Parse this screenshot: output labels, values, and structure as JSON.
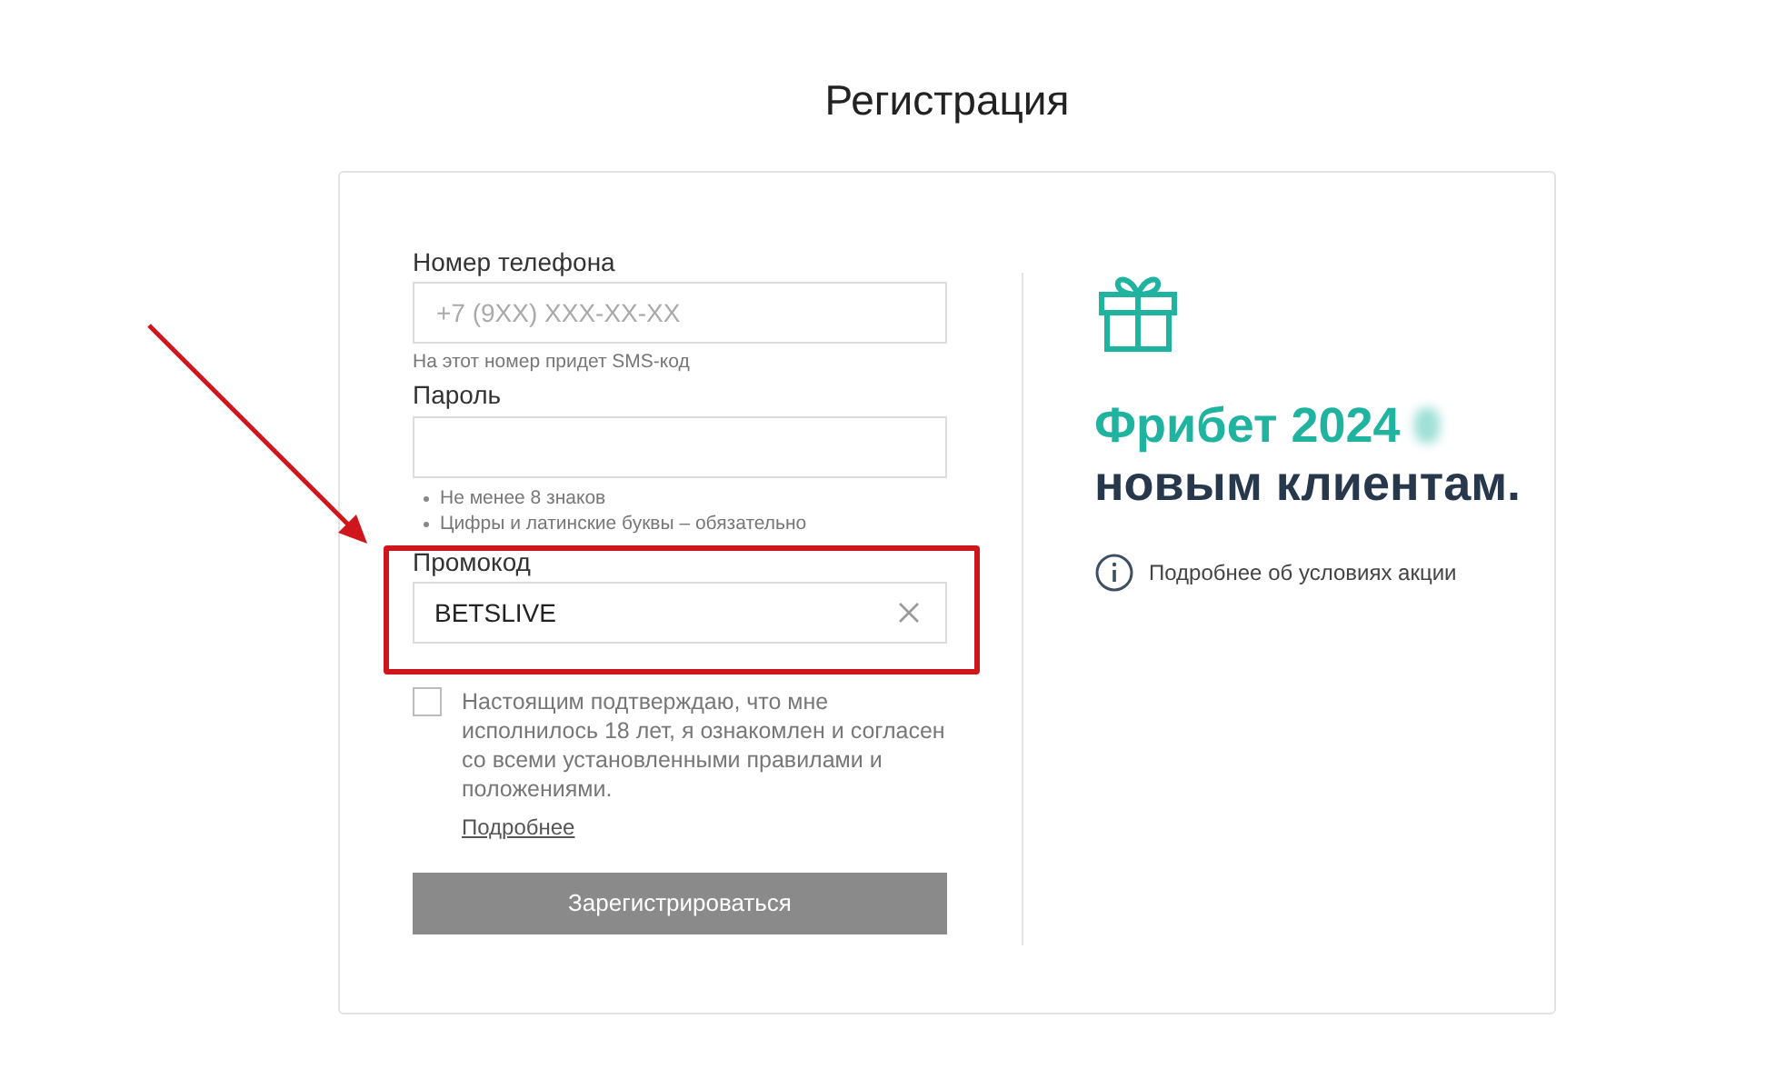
{
  "title": "Регистрация",
  "form": {
    "phone": {
      "label": "Номер телефона",
      "placeholder": "+7 (9XX) XXX-XX-XX",
      "hint": "На этот номер придет SMS-код"
    },
    "password": {
      "label": "Пароль",
      "rules": [
        "Не менее 8 знаков",
        "Цифры и латинские буквы – обязательно"
      ]
    },
    "promo": {
      "label": "Промокод",
      "value": "BETSLIVE",
      "highlighted": true
    },
    "consent": {
      "checked": false,
      "text": "Настоящим подтверждаю, что мне исполнилось 18 лет, я ознакомлен и согласен со всеми установленными правилами и положениями.",
      "link": "Подробнее"
    },
    "submit": {
      "label": "Зарегистрироваться",
      "disabled": true
    }
  },
  "promo_panel": {
    "headline": "Фрибет 2024",
    "subline": "новым клиентам.",
    "info_link": "Подробнее об условиях акции"
  }
}
